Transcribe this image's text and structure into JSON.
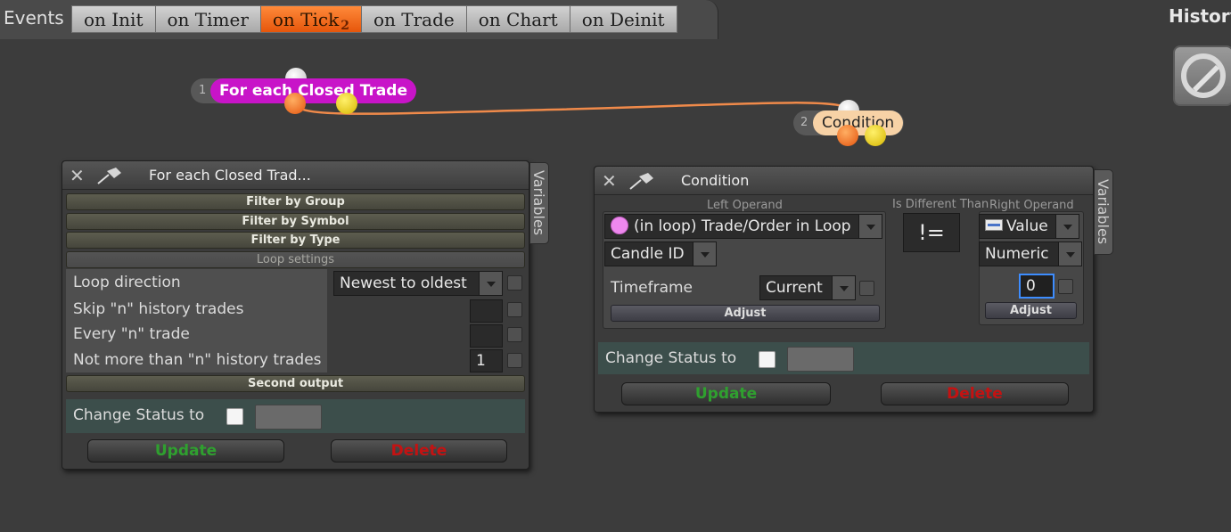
{
  "topbar": {
    "events_label": "Events",
    "tabs": [
      {
        "label": "on Init"
      },
      {
        "label": "on Timer"
      },
      {
        "label": "on Tick",
        "badge": "2"
      },
      {
        "label": "on Trade"
      },
      {
        "label": "on Chart"
      },
      {
        "label": "on Deinit"
      }
    ],
    "active_tab": "on Tick",
    "history_label": "History"
  },
  "nodes": [
    {
      "number": "1",
      "label": "For each Closed Trade",
      "color": "#c814c8"
    },
    {
      "number": "2",
      "label": "Condition",
      "color": "#f7d2a6"
    }
  ],
  "loop_panel": {
    "title": "For each Closed Trad...",
    "variables_tab": "Variables",
    "sections": [
      "Filter by Group",
      "Filter by Symbol",
      "Filter by Type",
      "Loop settings"
    ],
    "rows": [
      {
        "label": "Loop direction",
        "value": "Newest to oldest"
      },
      {
        "label": "Skip \"n\" history trades",
        "value": ""
      },
      {
        "label": "Every \"n\" trade",
        "value": ""
      },
      {
        "label": "Not more than \"n\" history trades",
        "value": "1"
      }
    ],
    "second_output": "Second output",
    "change_status_label": "Change Status to",
    "update_label": "Update",
    "delete_label": "Delete"
  },
  "condition_panel": {
    "title": "Condition",
    "variables_tab": "Variables",
    "left_operand_header": "Left Operand",
    "operator_header": "Is Different Than",
    "right_operand_header": "Right Operand",
    "left_operand_select": "(in loop) Trade/Order in Loop",
    "left_property_select": "Candle ID",
    "timeframe_label": "Timeframe",
    "timeframe_value": "Current",
    "adjust_label": "Adjust",
    "operator": "!=",
    "right_type_select": "Value",
    "right_subtype_select": "Numeric",
    "right_value": "0",
    "change_status_label": "Change Status to",
    "update_label": "Update",
    "delete_label": "Delete"
  },
  "colors": {
    "update": "#2fa02f",
    "delete": "#c41212",
    "active_tab": "#e6560b",
    "wire": "#f08a4a"
  }
}
